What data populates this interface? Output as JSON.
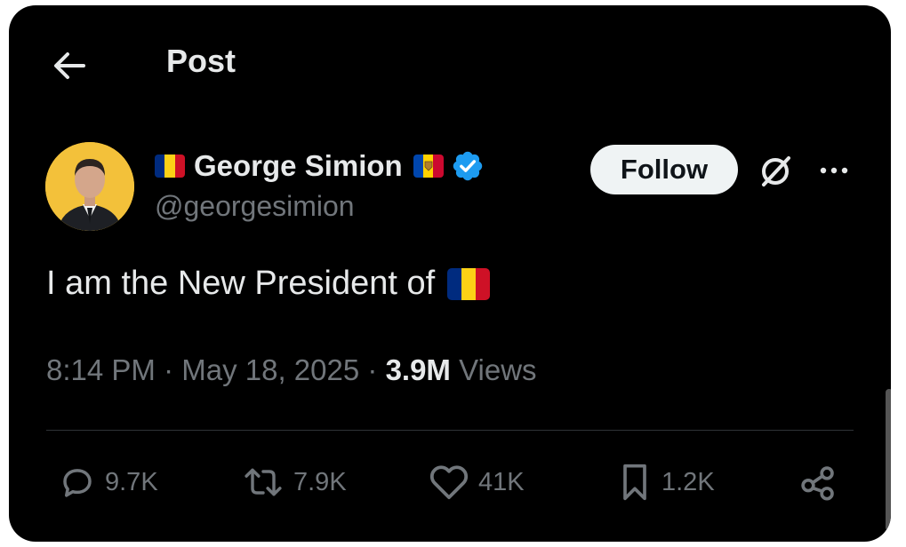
{
  "header": {
    "title": "Post"
  },
  "author": {
    "display_name": "George Simion",
    "handle": "@georgesimion",
    "verified": true
  },
  "follow_label": "Follow",
  "tweet": {
    "text": "I am the New President of"
  },
  "meta": {
    "time": "8:14 PM",
    "separator": "·",
    "date": "May 18, 2025",
    "views_count": "3.9M",
    "views_label": "Views"
  },
  "actions": {
    "replies": "9.7K",
    "reposts": "7.9K",
    "likes": "41K",
    "bookmarks": "1.2K"
  },
  "colors": {
    "background": "#000000",
    "text": "#e7e9ea",
    "muted": "#71767b",
    "verified": "#1d9bf0",
    "flag_blue": "#002b7f",
    "flag_yellow": "#fcd116",
    "flag_red": "#ce1126"
  }
}
